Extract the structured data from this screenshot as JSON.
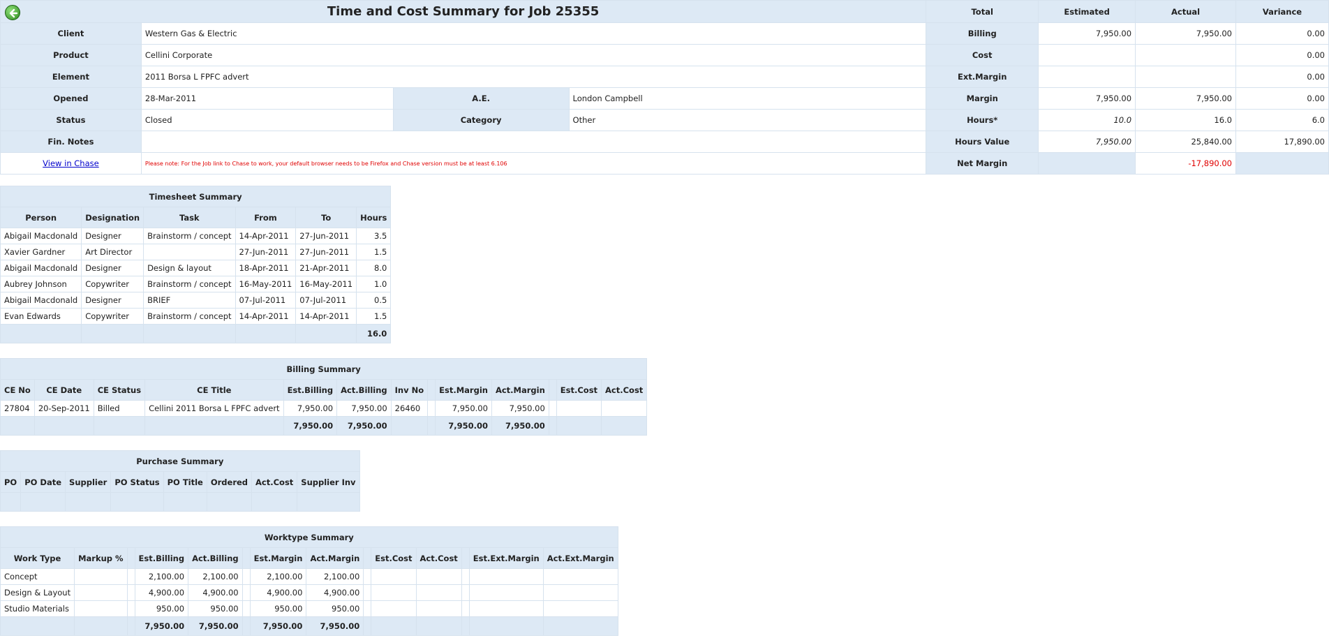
{
  "header": {
    "title": "Time and Cost Summary for Job 25355",
    "client_label": "Client",
    "client": "Western Gas & Electric",
    "product_label": "Product",
    "product": "Cellini Corporate",
    "element_label": "Element",
    "element": "2011 Borsa L FPFC advert",
    "opened_label": "Opened",
    "opened": "28-Mar-2011",
    "ae_label": "A.E.",
    "ae": "London Campbell",
    "status_label": "Status",
    "status": "Closed",
    "category_label": "Category",
    "category": "Other",
    "finnotes_label": "Fin. Notes",
    "finnotes": "",
    "view_link": "View in Chase",
    "note": "Please note: For the Job link to Chase to work, your default browser needs to be Firefox and Chase version must be at least 6.106"
  },
  "totals": {
    "headers": [
      "Total",
      "Estimated",
      "Actual",
      "Variance"
    ],
    "rows": [
      {
        "label": "Billing",
        "est": "7,950.00",
        "act": "7,950.00",
        "var": "0.00"
      },
      {
        "label": "Cost",
        "est": "",
        "act": "",
        "var": "0.00"
      },
      {
        "label": "Ext.Margin",
        "est": "",
        "act": "",
        "var": "0.00"
      },
      {
        "label": "Margin",
        "est": "7,950.00",
        "act": "7,950.00",
        "var": "0.00"
      },
      {
        "label": "Hours*",
        "est": "10.0",
        "act": "16.0",
        "var": "6.0"
      },
      {
        "label": "Hours Value",
        "est": "7,950.00",
        "act": "25,840.00",
        "var": "17,890.00"
      },
      {
        "label": "Net Margin",
        "est": "",
        "act": "-17,890.00",
        "var": ""
      }
    ]
  },
  "timesheet": {
    "title": "Timesheet Summary",
    "columns": [
      "Person",
      "Designation",
      "Task",
      "From",
      "To",
      "Hours"
    ],
    "rows": [
      [
        "Abigail Macdonald",
        "Designer",
        "Brainstorm / concept",
        "14-Apr-2011",
        "27-Jun-2011",
        "3.5"
      ],
      [
        "Xavier Gardner",
        "Art Director",
        "",
        "27-Jun-2011",
        "27-Jun-2011",
        "1.5"
      ],
      [
        "Abigail Macdonald",
        "Designer",
        "Design & layout",
        "18-Apr-2011",
        "21-Apr-2011",
        "8.0"
      ],
      [
        "Aubrey Johnson",
        "Copywriter",
        "Brainstorm / concept",
        "16-May-2011",
        "16-May-2011",
        "1.0"
      ],
      [
        "Abigail Macdonald",
        "Designer",
        "BRIEF",
        "07-Jul-2011",
        "07-Jul-2011",
        "0.5"
      ],
      [
        "Evan Edwards",
        "Copywriter",
        "Brainstorm / concept",
        "14-Apr-2011",
        "14-Apr-2011",
        "1.5"
      ]
    ],
    "total_hours": "16.0"
  },
  "billing": {
    "title": "Billing Summary",
    "columns": [
      "CE No",
      "CE Date",
      "CE Status",
      "CE Title",
      "Est.Billing",
      "Act.Billing",
      "Inv No",
      "Est.Margin",
      "Act.Margin",
      "Est.Cost",
      "Act.Cost"
    ],
    "rows": [
      [
        "27804",
        "20-Sep-2011",
        "Billed",
        "Cellini 2011 Borsa L FPFC advert",
        "7,950.00",
        "7,950.00",
        "26460",
        "7,950.00",
        "7,950.00",
        "",
        ""
      ]
    ],
    "totals": [
      "7,950.00",
      "7,950.00",
      "7,950.00",
      "7,950.00"
    ]
  },
  "purchase": {
    "title": "Purchase Summary",
    "columns": [
      "PO",
      "PO Date",
      "Supplier",
      "PO Status",
      "PO Title",
      "Ordered",
      "Act.Cost",
      "Supplier Inv"
    ]
  },
  "worktype": {
    "title": "Worktype Summary",
    "columns": [
      "Work Type",
      "Markup %",
      "Est.Billing",
      "Act.Billing",
      "Est.Margin",
      "Act.Margin",
      "Est.Cost",
      "Act.Cost",
      "Est.Ext.Margin",
      "Act.Ext.Margin"
    ],
    "rows": [
      [
        "Concept",
        "",
        "2,100.00",
        "2,100.00",
        "2,100.00",
        "2,100.00",
        "",
        "",
        "",
        ""
      ],
      [
        "Design & Layout",
        "",
        "4,900.00",
        "4,900.00",
        "4,900.00",
        "4,900.00",
        "",
        "",
        "",
        ""
      ],
      [
        "Studio Materials",
        "",
        "950.00",
        "950.00",
        "950.00",
        "950.00",
        "",
        "",
        "",
        ""
      ]
    ],
    "totals": [
      "7,950.00",
      "7,950.00",
      "7,950.00",
      "7,950.00"
    ]
  },
  "colors": {
    "header_bg": "#dde9f5",
    "negative": "#e00000",
    "link": "#0000cc",
    "back_icon": "#2e8a1e"
  }
}
